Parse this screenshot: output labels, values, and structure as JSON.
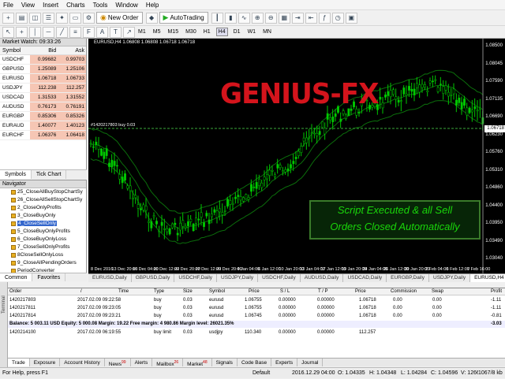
{
  "menu": [
    "File",
    "View",
    "Insert",
    "Charts",
    "Tools",
    "Window",
    "Help"
  ],
  "toolbar": {
    "new_order": "New Order",
    "autotrading": "AutoTrading"
  },
  "timeframes": [
    "M1",
    "M5",
    "M15",
    "M30",
    "H1",
    "H4",
    "D1",
    "W1",
    "MN"
  ],
  "active_timeframe": "H4",
  "market_watch": {
    "title": "Market Watch: 09:33:26",
    "cols": [
      "Symbol",
      "Bid",
      "Ask"
    ],
    "rows": [
      [
        "USDCHF",
        "0.99682",
        "0.99703"
      ],
      [
        "GBPUSD",
        "1.25089",
        "1.25106"
      ],
      [
        "EURUSD",
        "1.06718",
        "1.06733"
      ],
      [
        "USDJPY",
        "112.238",
        "112.257"
      ],
      [
        "USDCAD",
        "1.31533",
        "1.31552"
      ],
      [
        "AUDUSD",
        "0.76173",
        "0.76191"
      ],
      [
        "EURGBP",
        "0.85306",
        "0.85326"
      ],
      [
        "EURAUD",
        "1.40077",
        "1.40123"
      ],
      [
        "EURCHF",
        "1.06376",
        "1.06418"
      ]
    ],
    "tabs": [
      "Symbols",
      "Tick Chart"
    ]
  },
  "navigator": {
    "title": "Navigator",
    "items": [
      "25_CloseAllBuyStopChartSy",
      "26_CloseAllSellStopChartSy",
      "2_CloseOnlyProfits",
      "3_CloseBuyOnly",
      "4_CloseSellOnly",
      "5_CloseBuyOnlyProfits",
      "6_CloseBuyOnlyLoss",
      "7_CloseSellOnlyProfits",
      "8CloseSellOnlyLoss",
      "9_CloseAllPendingOrders",
      "PeriodConverter"
    ],
    "selected": 4,
    "tabs": [
      "Common",
      "Favorites"
    ]
  },
  "chart": {
    "title": "EURUSD,H4  1.06808 1.06808 1.06718 1.06718",
    "line_label": "#1420217803 buy 0.03",
    "watermark": "GENIUS-FX",
    "box_line1": "Script Executed & all Sell",
    "box_line2": "Orders Closed Automatically",
    "price_tag": "1.06718",
    "y_ticks": [
      "1.08500",
      "1.08045",
      "1.07590",
      "1.07135",
      "1.06690",
      "1.06230",
      "1.05760",
      "1.05310",
      "1.04860",
      "1.04400",
      "1.03950",
      "1.03490",
      "1.03040"
    ],
    "x_ticks": [
      "8 Dec 2016",
      "13 Dec 20:00",
      "16 Dec 04:00",
      "20 Dec 12:00",
      "22 Dec 20:00",
      "27 Dec 12:00",
      "29 Dec 20:00",
      "4 Jan 04:00",
      "6 Jan 12:00",
      "10 Jan 20:00",
      "13 Jan 04:00",
      "17 Jan 12:00",
      "19 Jan 20:00",
      "24 Jan 04:00",
      "26 Jan 12:00",
      "30 Jan 20:00",
      "2 Feb 04:00",
      "6 Feb 12:00",
      "7 Feb 16:00"
    ],
    "colors": {
      "candles": "#00c800",
      "bands": "#0b6e0b",
      "price_line": "#3aa83a"
    }
  },
  "chart_tabs": [
    "EURUSD,Daily",
    "GBPUSD,Daily",
    "USDCHF,Daily",
    "USDJPY,Daily",
    "USDCHF,Daily",
    "AUDUSD,Daily",
    "USDCAD,Daily",
    "EURGBP,Daily",
    "USDJPY,Daily",
    "EURUSD,H4"
  ],
  "terminal": {
    "side_label": "Terminal",
    "headers": [
      "Order",
      "/",
      "Time",
      "Type",
      "Size",
      "Symbol",
      "Price",
      "S / L",
      "T / P",
      "Price",
      "Commission",
      "Swap",
      "Profit"
    ],
    "rows": [
      [
        "1420217803",
        "2017.02.09 09:22:58",
        "buy",
        "0.03",
        "eurusd",
        "1.06755",
        "0.00000",
        "0.00000",
        "1.06718",
        "0.00",
        "0.00",
        "-1.11"
      ],
      [
        "1420217811",
        "2017.02.09 09:23:05",
        "buy",
        "0.03",
        "eurusd",
        "1.06755",
        "0.00000",
        "0.00000",
        "1.06718",
        "0.00",
        "0.00",
        "-1.11"
      ],
      [
        "1420217814",
        "2017.02.09 09:23:21",
        "buy",
        "0.03",
        "eurusd",
        "1.06745",
        "0.00000",
        "0.00000",
        "1.06718",
        "0.00",
        "0.00",
        "-0.81"
      ]
    ],
    "balance": "Balance: 5 003.11 USD  Equity: 5 000.08  Margin: 19.22  Free margin: 4 980.86  Margin level: 26021.35%",
    "balance_profit": "-3.03",
    "pending": [
      "1420214100",
      "2017.02.09 06:19:55",
      "buy limit",
      "0.03",
      "usdjpy",
      "110.340",
      "0.00000",
      "0.00000",
      "112.257"
    ],
    "tabs": [
      {
        "label": "Trade",
        "badge": ""
      },
      {
        "label": "Exposure",
        "badge": ""
      },
      {
        "label": "Account History",
        "badge": ""
      },
      {
        "label": "News",
        "badge": "99"
      },
      {
        "label": "Alerts",
        "badge": ""
      },
      {
        "label": "Mailbox",
        "badge": "26"
      },
      {
        "label": "Market",
        "badge": "48"
      },
      {
        "label": "Signals",
        "badge": ""
      },
      {
        "label": "Code Base",
        "badge": ""
      },
      {
        "label": "Experts",
        "badge": ""
      },
      {
        "label": "Journal",
        "badge": ""
      }
    ]
  },
  "status": {
    "help": "For Help, press F1",
    "default": "Default",
    "datetime": "2016.12.29 04:00",
    "open": "O: 1.04335",
    "high": "H: 1.04348",
    "low": "L: 1.04284",
    "close": "C: 1.04596",
    "volume": "V: 12662",
    "traffic": "1067/8 kb"
  }
}
